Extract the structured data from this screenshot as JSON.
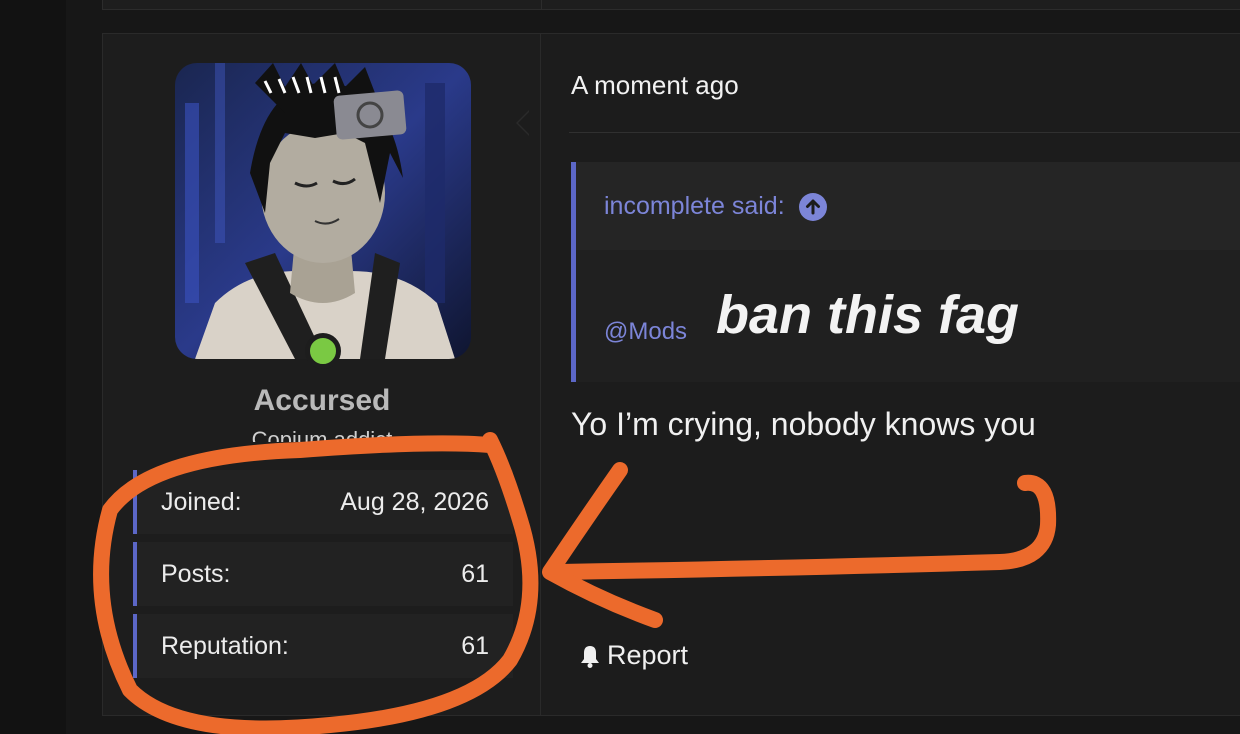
{
  "user": {
    "name": "Accursed",
    "title": "Copium addict",
    "online": true,
    "stats": [
      {
        "label": "Joined:",
        "value": "Aug 28, 2026"
      },
      {
        "label": "Posts:",
        "value": "61"
      },
      {
        "label": "Reputation:",
        "value": "61"
      }
    ]
  },
  "post": {
    "date": "A moment ago",
    "quote": {
      "attribution": "incomplete said:",
      "mention": "@Mods",
      "text": "ban this fag"
    },
    "body": "Yo I’m crying, nobody knows you",
    "report_label": "Report"
  },
  "colors": {
    "accent": "#5c67c7",
    "link": "#7c85d8",
    "online": "#7ac943",
    "annotation": "#ec6a2c",
    "background": "#1c1c1c"
  },
  "icons": [
    "arrow-up-circle-icon",
    "bell-icon",
    "online-status-icon"
  ]
}
